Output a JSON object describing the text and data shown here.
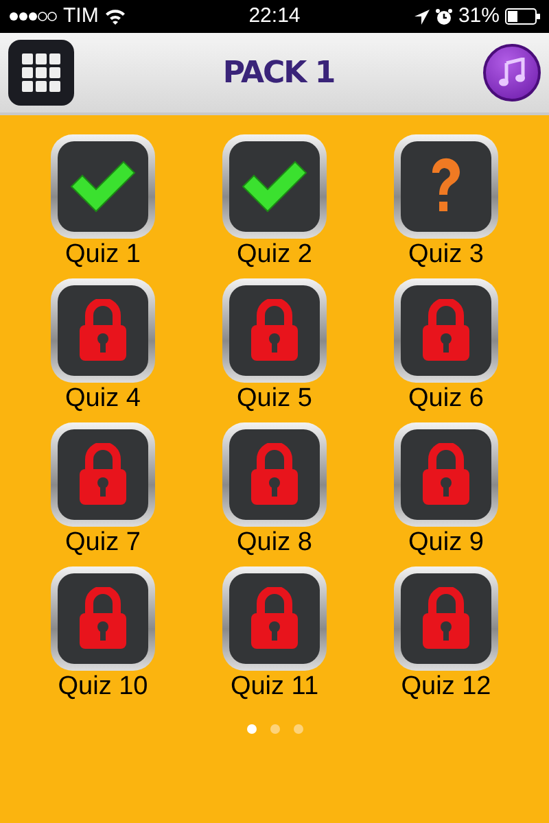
{
  "status_bar": {
    "carrier": "TIM",
    "time": "22:14",
    "battery": "31%"
  },
  "header": {
    "title": "PACK 1"
  },
  "quizzes": [
    {
      "label": "Quiz 1",
      "kind": "done"
    },
    {
      "label": "Quiz 2",
      "kind": "done"
    },
    {
      "label": "Quiz 3",
      "kind": "current"
    },
    {
      "label": "Quiz 4",
      "kind": "locked"
    },
    {
      "label": "Quiz 5",
      "kind": "locked"
    },
    {
      "label": "Quiz 6",
      "kind": "locked"
    },
    {
      "label": "Quiz 7",
      "kind": "locked"
    },
    {
      "label": "Quiz 8",
      "kind": "locked"
    },
    {
      "label": "Quiz 9",
      "kind": "locked"
    },
    {
      "label": "Quiz 10",
      "kind": "locked"
    },
    {
      "label": "Quiz 11",
      "kind": "locked"
    },
    {
      "label": "Quiz 12",
      "kind": "locked"
    }
  ],
  "pages": [
    {
      "selected": true
    },
    {
      "selected": false
    },
    {
      "selected": false
    }
  ]
}
